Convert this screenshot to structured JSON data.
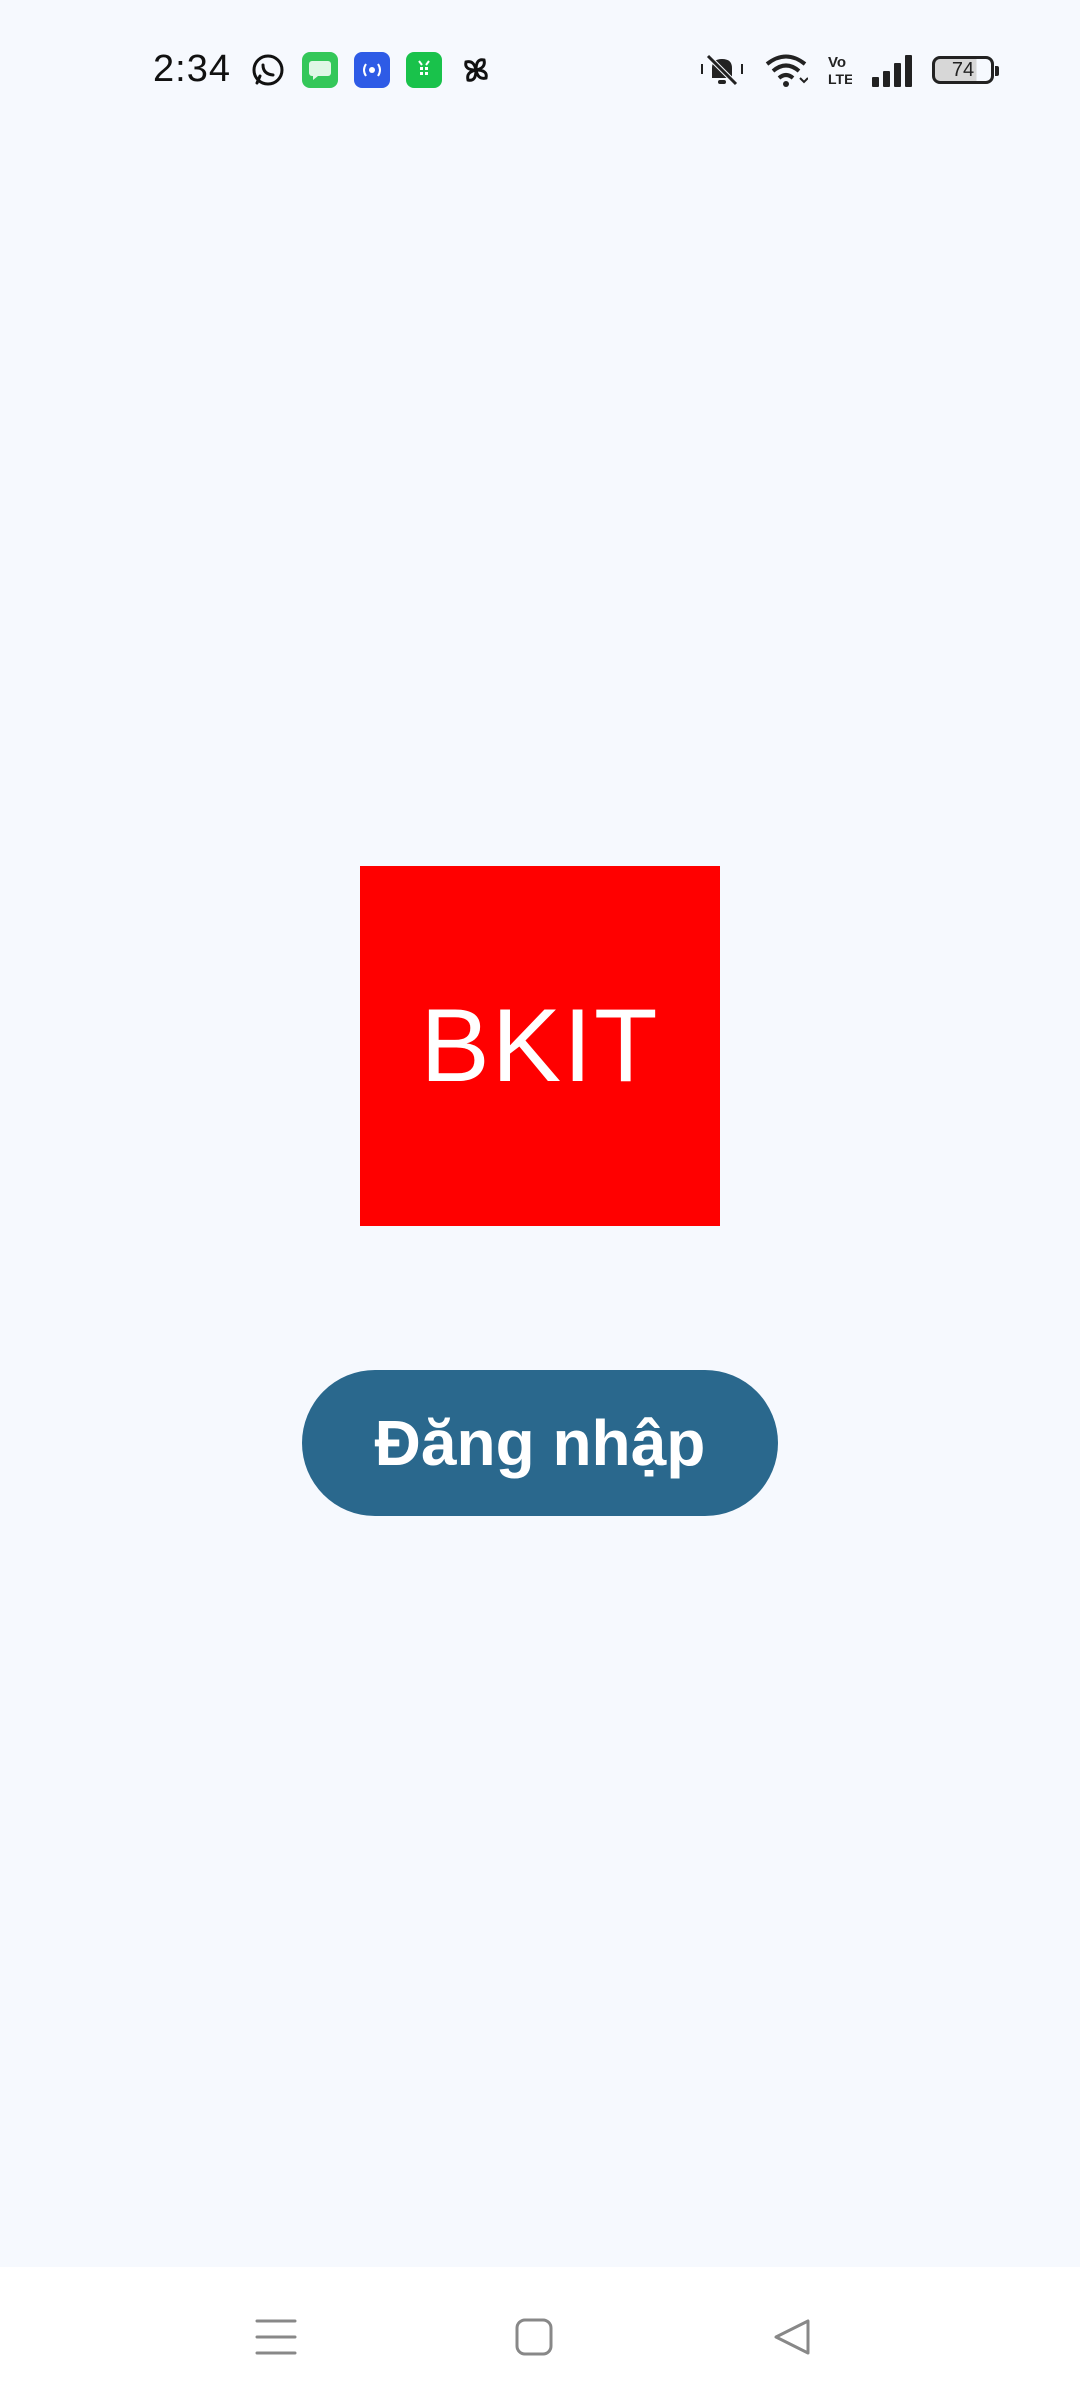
{
  "status_bar": {
    "time": "2:34",
    "battery_level": "74",
    "notification_icons": [
      "whatsapp-icon",
      "messages-icon",
      "podcast-icon",
      "app-store-icon",
      "pinwheel-icon"
    ],
    "system_icons": [
      "mute-bell-icon",
      "wifi-icon",
      "volte-icon",
      "signal-icon",
      "battery-icon"
    ]
  },
  "logo": {
    "text": "BKIT",
    "background_color": "#FF0000"
  },
  "login": {
    "label": "Đăng nhập",
    "color": "#2A688D"
  },
  "nav_bar": {
    "items": [
      "menu-icon",
      "home-icon",
      "back-icon"
    ]
  }
}
